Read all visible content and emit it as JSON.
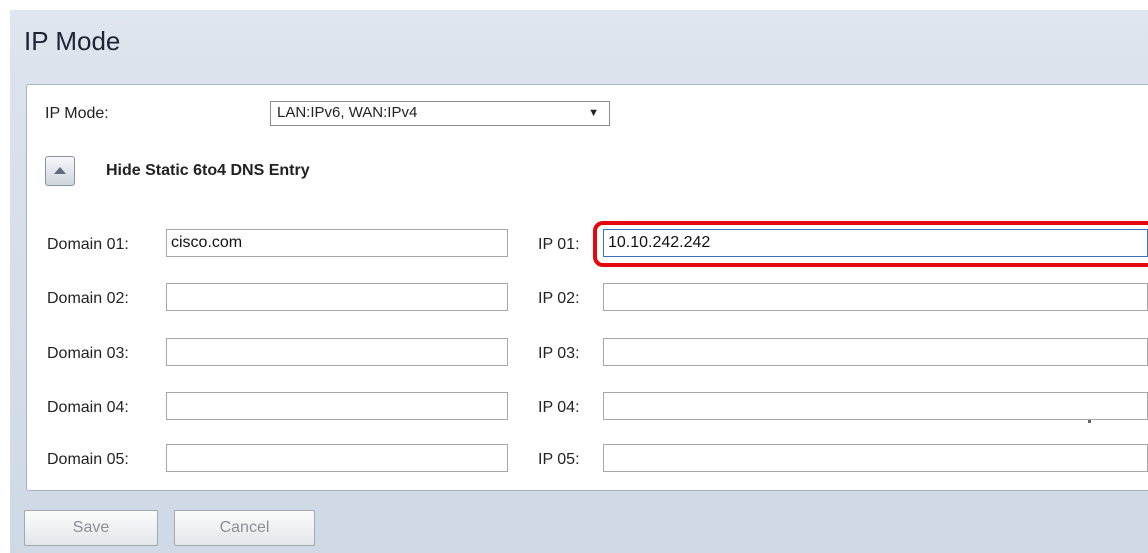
{
  "page": {
    "title": "IP Mode"
  },
  "ip_mode": {
    "label": "IP Mode:",
    "selected": "LAN:IPv6, WAN:IPv4"
  },
  "toggle": {
    "label": "Hide Static 6to4 DNS Entry"
  },
  "entries": [
    {
      "domain_label": "Domain 01:",
      "domain_value": "cisco.com",
      "ip_label": "IP 01:",
      "ip_value": "10.10.242.242"
    },
    {
      "domain_label": "Domain 02:",
      "domain_value": "",
      "ip_label": "IP 02:",
      "ip_value": ""
    },
    {
      "domain_label": "Domain 03:",
      "domain_value": "",
      "ip_label": "IP 03:",
      "ip_value": ""
    },
    {
      "domain_label": "Domain 04:",
      "domain_value": "",
      "ip_label": "IP 04:",
      "ip_value": ""
    },
    {
      "domain_label": "Domain 05:",
      "domain_value": "",
      "ip_label": "IP 05:",
      "ip_value": ""
    }
  ],
  "buttons": {
    "save": "Save",
    "cancel": "Cancel"
  },
  "colors": {
    "highlight": "#e3070d",
    "background": "#d7dfea"
  }
}
